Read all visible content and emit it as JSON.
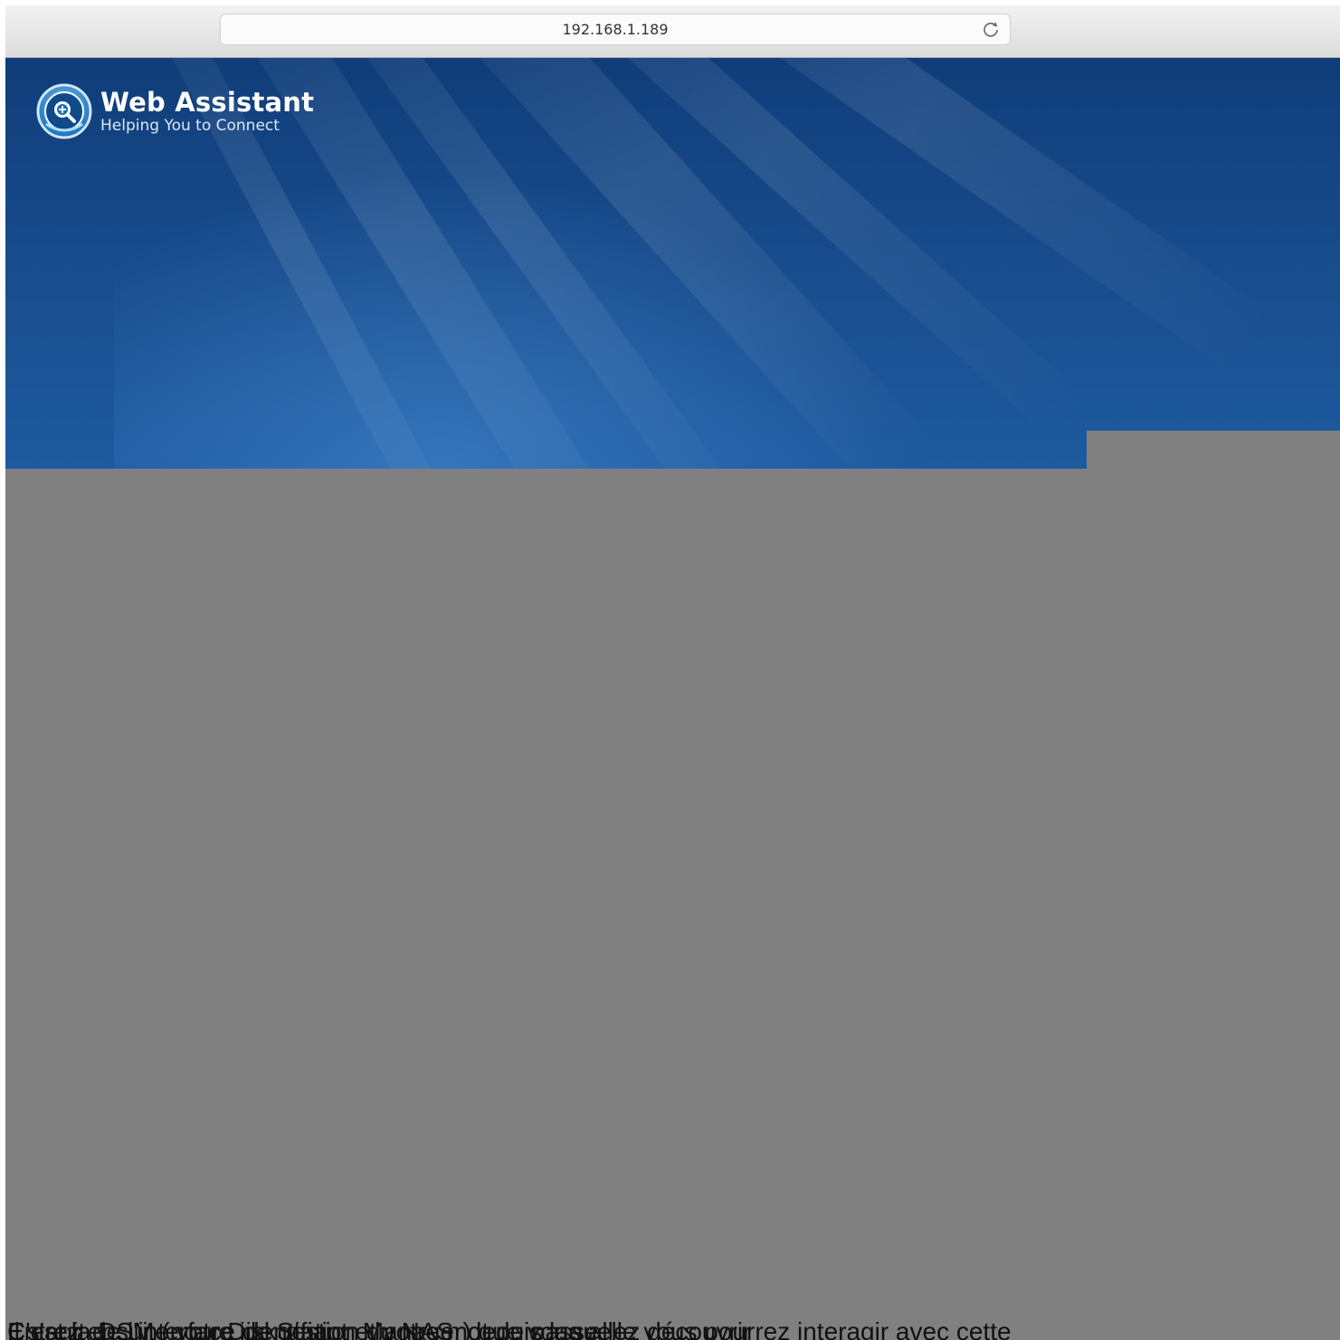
{
  "browser": {
    "url": "192.168.1.189",
    "reload_icon": "reload-icon"
  },
  "app": {
    "title": "Web Assistant",
    "subtitle": "Helping You to Connect",
    "logo_icon": "magnifier-plus-icon"
  },
  "colors": {
    "banner_dark": "#0f3d7a",
    "banner_light": "#1e5aa0",
    "overlay": "#808080"
  },
  "footer_text": [
    "Entrez ensuite votre identifiant et votre mot de passe",
    "C'est la DSM (pour DiskStation Manager) que vous allez découvrir",
    "Il s'agit de l'interface de gestion du NAS, depuis laquelle vous pourrez interagir avec cette"
  ]
}
